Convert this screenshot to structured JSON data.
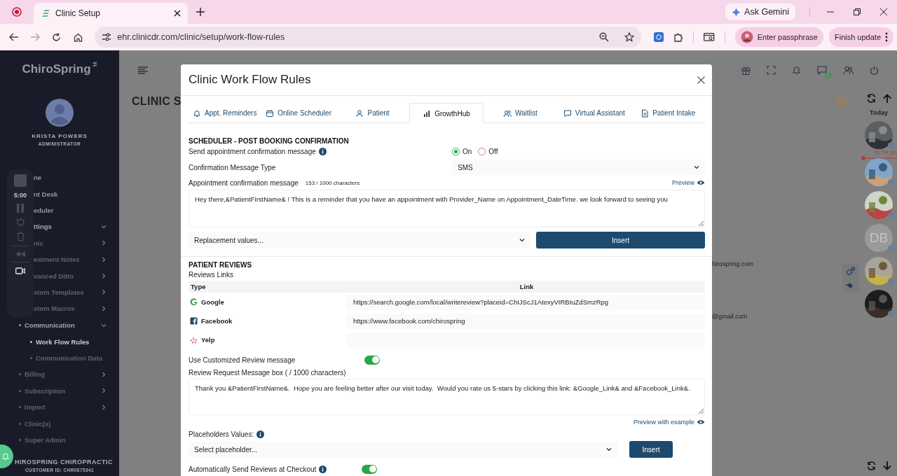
{
  "browser": {
    "tab_title": "Clinic Setup",
    "address": "ehr.clinicdr.com/clinic/setup/work-flow-rules",
    "gemini_button": "Ask Gemini",
    "profile_button": "Enter passphrase",
    "update_button": "Finish update"
  },
  "sidebar": {
    "logo": "ChiroSpring",
    "user_name": "KRISTA POWERS",
    "user_role": "ADMINISTRATOR",
    "recorder_time": "5:00",
    "items": [
      {
        "label": "ne",
        "kind": "link",
        "selected": false
      },
      {
        "label": "nt Desk",
        "kind": "link",
        "selected": false
      },
      {
        "label": "eduler",
        "kind": "link",
        "selected": false
      },
      {
        "label": "ttings",
        "kind": "group",
        "expanded": true,
        "selected": false,
        "children": [
          {
            "label": "nic",
            "kind": "group",
            "expanded": false,
            "selected": false
          },
          {
            "label": "eatment Notes",
            "kind": "group",
            "expanded": false,
            "selected": false
          },
          {
            "label": "vanced Ditto",
            "kind": "group",
            "expanded": false,
            "selected": false
          },
          {
            "label": "stom Templates",
            "kind": "group",
            "expanded": false,
            "selected": false
          },
          {
            "label": "stom Macros",
            "kind": "group",
            "expanded": false,
            "selected": false
          },
          {
            "label": "Communication",
            "kind": "group",
            "expanded": true,
            "selected": false,
            "children": [
              {
                "label": "Work Flow Rules",
                "kind": "link",
                "selected": true
              },
              {
                "label": "Communication Data",
                "kind": "link",
                "selected": false
              }
            ]
          },
          {
            "label": "Billing",
            "kind": "group",
            "expanded": false,
            "selected": false
          },
          {
            "label": "Subscription",
            "kind": "group",
            "expanded": false,
            "selected": false
          },
          {
            "label": "Import",
            "kind": "group",
            "expanded": false,
            "selected": false
          },
          {
            "label": "Clinic(s)",
            "kind": "link",
            "selected": false
          },
          {
            "label": "Super Admin",
            "kind": "link",
            "selected": false
          }
        ]
      }
    ],
    "clinic_name": "HIROSPRING CHIROPRACTIC",
    "customer_id": "CUSTOMER ID: CHR0875341"
  },
  "topbar": {
    "messages_badge": "0"
  },
  "page": {
    "title": "CLINIC S",
    "email_1": "hirospring.com",
    "email_2": "@gmail.com"
  },
  "schedule_rail": {
    "heading": "Today",
    "time_marker": "01:24 pm",
    "avatars": [
      {
        "kind": "picture"
      },
      {
        "kind": "picture"
      },
      {
        "kind": "picture"
      },
      {
        "kind": "initials",
        "initials": "DB"
      },
      {
        "kind": "picture"
      },
      {
        "kind": "picture"
      }
    ]
  },
  "modal": {
    "title": "Clinic Work Flow Rules",
    "tabs": [
      {
        "label": "Appt. Reminders",
        "selected": false
      },
      {
        "label": "Online Scheduler",
        "selected": false
      },
      {
        "label": "Patient",
        "selected": false
      },
      {
        "label": "GrowthHub",
        "selected": true
      },
      {
        "label": "Waitlist",
        "selected": false
      },
      {
        "label": "Virtual Assistant",
        "selected": false
      },
      {
        "label": "Patient Intake",
        "selected": false
      }
    ],
    "confirmation": {
      "heading": "SCHEDULER - POST BOOKING CONFIRMATION",
      "send_label": "Send appointment confirmation message",
      "options": [
        {
          "label": "On",
          "selected": true
        },
        {
          "label": "Off",
          "selected": false
        }
      ],
      "type_label": "Confirmation Message Type",
      "type_value": "SMS",
      "message_label": "Appointment confirmation message",
      "counter": "153 / 1000 characters",
      "preview_link": "Preview",
      "message": "Hey there,&PatientFirstName& ! This is a reminder that you have an appointment with Provider_Name on Appointment_DateTime. we look forward to seeing you",
      "replacement_value": "Replacement values...",
      "insert_button": "Insert"
    },
    "reviews": {
      "heading": "PATIENT REVIEWS",
      "links_label": "Reviews Links",
      "columns": [
        "Type",
        "Link"
      ],
      "rows": [
        {
          "type": "Google",
          "link": "https://search.google.com/local/writereview?placeid=ChIJScJ1AtexyVIRBIuZdSmzRpg"
        },
        {
          "type": "Facebook",
          "link": "https://www.facebook.com/chirospring"
        },
        {
          "type": "Yelp"
        }
      ],
      "custom_label": "Use Customized Review message",
      "custom_on": true,
      "request_label": "Review Request Message box ( / 1000 characters)",
      "request_message": "Thank you &PatientFirstName&.  Hope you are feeling better after our visit today.  Would you rate us 5-stars by clicking this link: &Google_Link& and &Facebook_Link&.",
      "preview_link": "Preview with example",
      "placeholders_label": "Placeholders Values:",
      "placeholder_select": "Select placeholder...",
      "insert_button": "Insert",
      "auto_label": "Automatically Send Reviews at Checkout",
      "auto_on": true
    }
  }
}
